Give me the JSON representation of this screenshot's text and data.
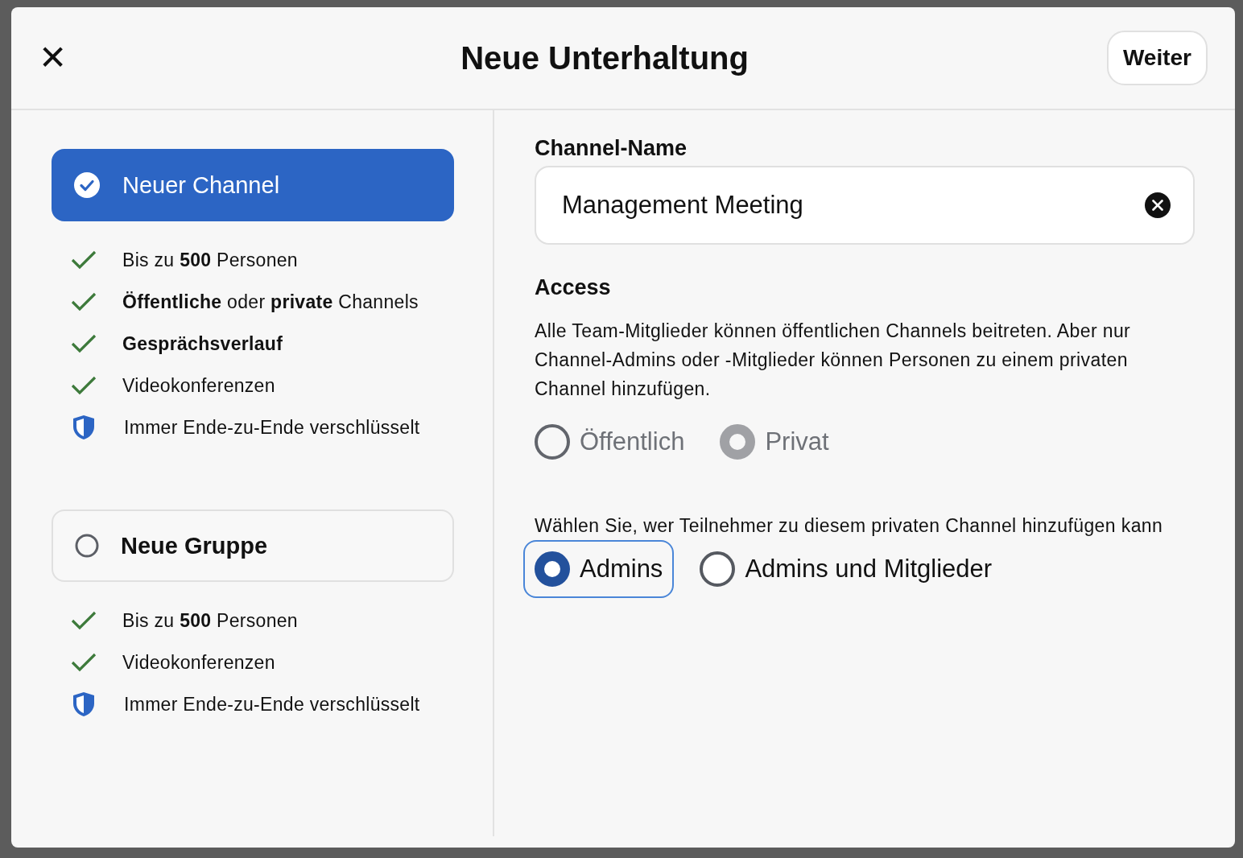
{
  "dialog": {
    "title": "Neue Unterhaltung",
    "close_icon": "✕",
    "next_button": "Weiter"
  },
  "options": [
    {
      "label": "Neuer Channel",
      "selected": true,
      "features": [
        {
          "kind": "check",
          "text": "Bis zu **500** Personen"
        },
        {
          "kind": "check",
          "text": "**Öffentliche** oder **private** Channels"
        },
        {
          "kind": "check",
          "text": "**Gesprächsverlauf**"
        },
        {
          "kind": "check",
          "text": "Videokonferenzen"
        },
        {
          "kind": "shield",
          "text": "Immer Ende-zu-Ende verschlüsselt"
        }
      ]
    },
    {
      "label": "Neue Gruppe",
      "selected": false,
      "features": [
        {
          "kind": "check",
          "text": "Bis zu **500** Personen"
        },
        {
          "kind": "check",
          "text": "Videokonferenzen"
        },
        {
          "kind": "shield",
          "text": "Immer Ende-zu-Ende verschlüsselt"
        }
      ]
    }
  ],
  "channel_name": {
    "label": "Channel-Name",
    "value": "Management Meeting"
  },
  "access": {
    "heading": "Access",
    "description": "Alle Team-Mitglieder können öffentlichen Channels beitreten. Aber nur Channel-Admins oder -Mitglieder können Personen zu einem privaten Channel hinzufügen.",
    "options": [
      {
        "label": "Öffentlich",
        "selected": false,
        "disabled": true
      },
      {
        "label": "Privat",
        "selected": true,
        "disabled": true
      }
    ]
  },
  "add_members": {
    "prompt": "Wählen Sie, wer Teilnehmer zu diesem privaten Channel hinzufügen kann",
    "options": [
      {
        "label": "Admins",
        "selected": true
      },
      {
        "label": "Admins und Mitglieder",
        "selected": false
      }
    ]
  }
}
